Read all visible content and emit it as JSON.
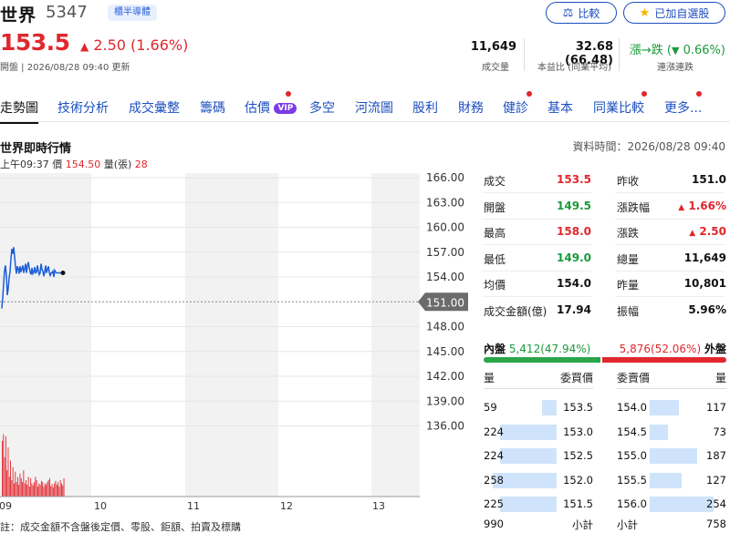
{
  "header": {
    "name": "世界",
    "code": "5347",
    "badge": "櫃半導體",
    "compare_label": "比較",
    "added_label": "已加自選股"
  },
  "quote": {
    "price": "153.5",
    "change": "2.50 (1.66%)",
    "meta": "開盤 | 2026/08/28 09:40 更新"
  },
  "kpis": [
    {
      "value": "11,649",
      "label": "成交量"
    },
    {
      "value": "32.68 (66.48)",
      "label": "本益比 (同業平均)"
    }
  ],
  "streak": {
    "value_prefix": "漲→跌 (",
    "value_pct": "0.66%",
    "value_suffix": ")",
    "label": "連漲連跌"
  },
  "tabs": [
    {
      "label": "走勢圖",
      "active": true
    },
    {
      "label": "技術分析"
    },
    {
      "label": "成交彙整"
    },
    {
      "label": "籌碼"
    },
    {
      "label": "估價",
      "vip": "VIP",
      "dot": true
    },
    {
      "label": "多空"
    },
    {
      "label": "河流圖"
    },
    {
      "label": "股利"
    },
    {
      "label": "財務"
    },
    {
      "label": "健診",
      "dot": true
    },
    {
      "label": "基本"
    },
    {
      "label": "同業比較",
      "dot": true
    },
    {
      "label": "更多...",
      "dot": true
    }
  ],
  "section": {
    "title": "世界即時行情",
    "data_time": "資料時間：2026/08/28 09:40",
    "cursor_time": "上午09:37",
    "cursor_price_label": "價",
    "cursor_price": "154.50",
    "cursor_vol_label": "量(張)",
    "cursor_vol": "28"
  },
  "chart_data": {
    "type": "line",
    "y_ticks": [
      "166.00",
      "163.00",
      "160.00",
      "157.00",
      "154.00",
      "151.00",
      "148.00",
      "145.00",
      "142.00",
      "139.00",
      "136.00"
    ],
    "x_ticks": [
      "09",
      "10",
      "11",
      "12",
      "13"
    ],
    "ylim": [
      136,
      166
    ],
    "reference_price": 151.0,
    "reference_label": "151.00",
    "series": [
      {
        "values": [
          150.2,
          151.5,
          153.3,
          154.8,
          155.4,
          154.1,
          151.8,
          152.6,
          153.9,
          154.6,
          156.2,
          157.4,
          156.8,
          157.6,
          156.5,
          155.2,
          154.4,
          155.3,
          155.0,
          154.4,
          155.3,
          154.6,
          155.0,
          155.4,
          154.5,
          155.0,
          155.6,
          154.5,
          155.3,
          155.8,
          155.1,
          154.6,
          154.3,
          155.1,
          154.4,
          154.6,
          155.2,
          154.5,
          154.6,
          155.4,
          154.8,
          154.3,
          154.5,
          155.6,
          154.9,
          154.7,
          154.1,
          154.6,
          155.4,
          154.5,
          154.9,
          155.3,
          154.6,
          154.1,
          154.5,
          154.5,
          154.7,
          154.0,
          154.8,
          154.6,
          154.5,
          154.5,
          154.5,
          154.5,
          154.5,
          154.5,
          154.5,
          154.5
        ]
      }
    ],
    "volume": [
      85,
      95,
      60,
      92,
      40,
      75,
      30,
      55,
      25,
      45,
      20,
      38,
      22,
      30,
      18,
      35,
      28,
      22,
      40,
      20,
      25,
      18,
      30,
      15,
      28,
      20,
      17,
      22,
      30,
      25,
      15,
      20,
      18,
      24,
      22,
      15,
      20,
      18,
      22,
      25,
      28,
      16,
      19,
      14,
      20,
      24,
      18,
      22,
      15,
      25,
      20,
      17,
      28
    ]
  },
  "stats": [
    {
      "l1": "成交",
      "v1": "153.5",
      "c1": "red",
      "l2": "昨收",
      "v2": "151.0",
      "c2": "dark"
    },
    {
      "l1": "開盤",
      "v1": "149.5",
      "c1": "green",
      "l2": "漲跌幅",
      "v2": "1.66%",
      "c2": "red",
      "tri2": true
    },
    {
      "l1": "最高",
      "v1": "158.0",
      "c1": "red",
      "l2": "漲跌",
      "v2": "2.50",
      "c2": "red",
      "tri2": true
    },
    {
      "l1": "最低",
      "v1": "149.0",
      "c1": "green",
      "l2": "總量",
      "v2": "11,649",
      "c2": "dark"
    },
    {
      "l1": "均價",
      "v1": "154.0",
      "c1": "dark",
      "l2": "昨量",
      "v2": "10,801",
      "c2": "dark"
    },
    {
      "l1": "成交金額(億)",
      "v1": "17.94",
      "c1": "dark",
      "l2": "振幅",
      "v2": "5.96%",
      "c2": "dark"
    }
  ],
  "inout": {
    "in_label": "內盤",
    "in_val": "5,412(47.94%)",
    "out_val": "5,876(52.06%)",
    "out_label": "外盤",
    "in_fraction": 0.4794
  },
  "orderbook": {
    "headers": [
      "量",
      "委買價",
      "委賣價",
      "量"
    ],
    "bids": [
      {
        "qty": "59",
        "price": "153.5",
        "fill": 0.23
      },
      {
        "qty": "224",
        "price": "153.0",
        "fill": 0.89
      },
      {
        "qty": "224",
        "price": "152.5",
        "fill": 0.89
      },
      {
        "qty": "258",
        "price": "152.0",
        "fill": 1.0
      },
      {
        "qty": "225",
        "price": "151.5",
        "fill": 0.89
      }
    ],
    "asks": [
      {
        "price": "154.0",
        "qty": "117",
        "fill": 0.46
      },
      {
        "price": "154.5",
        "qty": "73",
        "fill": 0.29
      },
      {
        "price": "155.0",
        "qty": "187",
        "fill": 0.74
      },
      {
        "price": "155.5",
        "qty": "127",
        "fill": 0.5
      },
      {
        "price": "156.0",
        "qty": "254",
        "fill": 1.0
      }
    ],
    "total_bid": "990",
    "total_bid_label": "小計",
    "total_ask_label": "小計",
    "total_ask": "758"
  },
  "footnote": "註：成交金額不含盤後定價、零股、鉅額、拍賣及標購",
  "colors": {
    "up": "#e0272d",
    "down": "#1a9a3a",
    "line": "#1d5fd8",
    "link": "#1d4fbf"
  }
}
